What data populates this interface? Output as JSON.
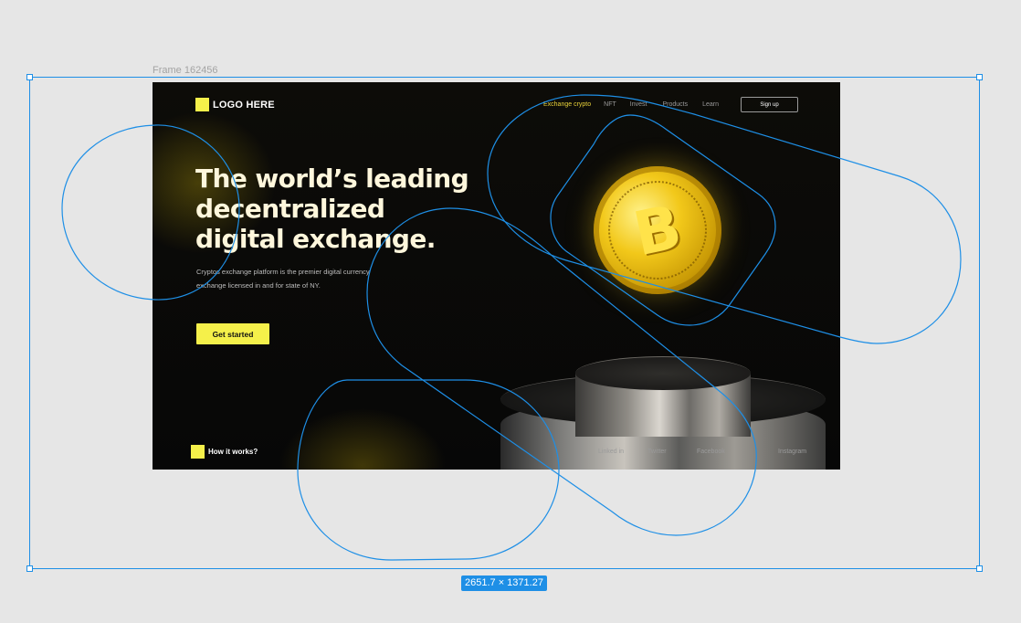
{
  "editor": {
    "frame_label": "Frame 162456",
    "dimensions": "2651.7 × 1371.27"
  },
  "site": {
    "logo_text": "LOGO HERE",
    "nav": [
      {
        "label": "Exchange crypto",
        "active": true
      },
      {
        "label": "NFT",
        "active": false
      },
      {
        "label": "Invest",
        "active": false
      },
      {
        "label": "Products",
        "active": false
      },
      {
        "label": "Learn",
        "active": false
      }
    ],
    "signup_label": "Sign up",
    "hero": {
      "title_lines": [
        "The world’s leading",
        "decentralized",
        "digital exchange."
      ],
      "subtitle_lines": [
        "Cryptos exchange platform is the premier digital currency",
        "exchange licensed in and for state of NY."
      ],
      "cta_label": "Get started"
    },
    "how_label": "How it works?",
    "social": [
      "Linked in",
      "Twitter",
      "Facebook",
      "Instagram"
    ],
    "coin_symbol": "B"
  },
  "colors": {
    "accent": "#f5f04a",
    "nav_active": "#e8d23a",
    "selection": "#1e8fe6",
    "background": "#e6e6e6"
  },
  "icons": {
    "logo_mark": "yellow-square-icon",
    "how_mark": "yellow-square-icon",
    "coin": "bitcoin-coin-icon"
  }
}
